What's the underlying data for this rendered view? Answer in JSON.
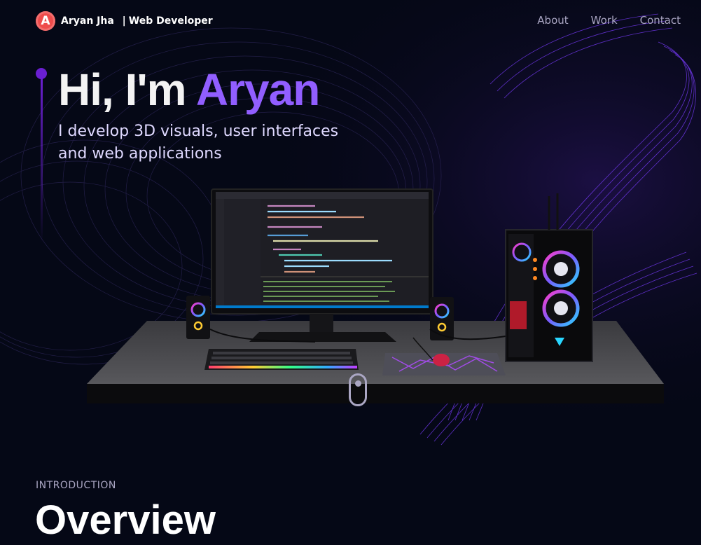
{
  "brand": {
    "logo_letter": "A",
    "name": "Aryan Jha",
    "separator": "|",
    "role": "Web Developer"
  },
  "nav": {
    "links": [
      "About",
      "Work",
      "Contact"
    ]
  },
  "hero": {
    "greeting": "Hi, I'm ",
    "name": "Aryan",
    "subtitle": "I develop 3D visuals, user interfaces and web applications"
  },
  "overview": {
    "eyebrow": "INTRODUCTION",
    "heading": "Overview"
  },
  "colors": {
    "background": "#050816",
    "accent": "#915eff",
    "secondary_text": "#aaa6c3",
    "logo_red": "#ee4b4b"
  }
}
